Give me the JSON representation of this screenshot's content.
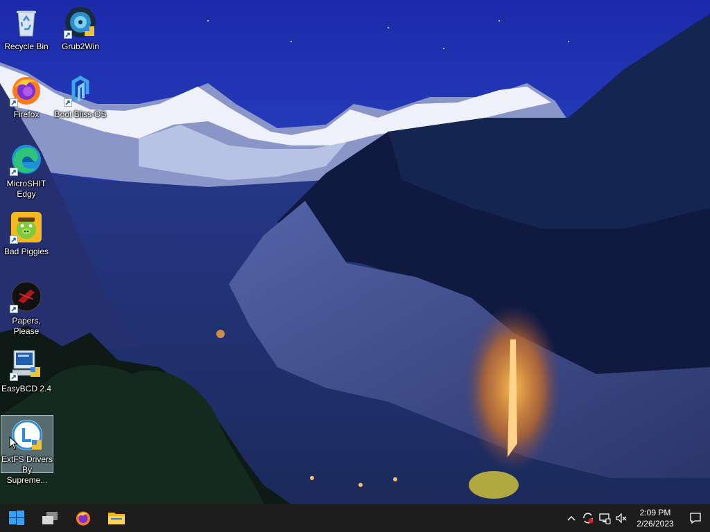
{
  "desktop": {
    "icons": [
      {
        "label": "Recycle Bin",
        "icon": "recycle-bin-icon"
      },
      {
        "label": "Grub2Win",
        "icon": "grub2win-icon"
      },
      {
        "label": "Firefox",
        "icon": "firefox-icon"
      },
      {
        "label": "Boot Bliss-OS",
        "icon": "bliss-os-icon"
      },
      {
        "label": "MicroSHIT Edgy",
        "icon": "edge-icon"
      },
      {
        "label": "Bad Piggies",
        "icon": "bad-piggies-icon"
      },
      {
        "label": "Papers, Please",
        "icon": "papers-please-icon"
      },
      {
        "label": "EasyBCD 2.4",
        "icon": "easybcd-icon"
      },
      {
        "label": "ExtFS Drivers By Supreme...",
        "icon": "extfs-drivers-icon"
      }
    ]
  },
  "taskbar": {
    "start": "windows-start-icon",
    "pinned": [
      "task-view-icon",
      "firefox-icon",
      "file-explorer-icon"
    ],
    "tray_icons": [
      "chevron-up-icon",
      "sync-icon",
      "network-icon",
      "volume-muted-icon"
    ],
    "clock_time": "2:09 PM",
    "clock_date": "2/26/2023",
    "notification": "notification-icon"
  },
  "colors": {
    "taskbar": "#1d1d1d",
    "sky": "#2c3fc4",
    "selection": "#b4c8e1"
  }
}
